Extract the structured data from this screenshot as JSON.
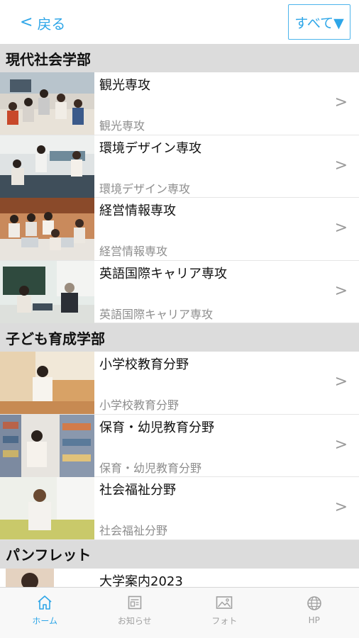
{
  "topbar": {
    "back_label": "戻る",
    "filter_label": "すべて▼"
  },
  "sections": [
    {
      "title": "現代社会学部",
      "rows": [
        {
          "title": "観光専攻",
          "subtitle": "観光専攻",
          "photo": "classroom-group"
        },
        {
          "title": "環境デザイン専攻",
          "subtitle": "環境デザイン専攻",
          "photo": "laboratory"
        },
        {
          "title": "経営情報専攻",
          "subtitle": "経営情報専攻",
          "photo": "computer-room"
        },
        {
          "title": "英語国際キャリア専攻",
          "subtitle": "英語国際キャリア専攻",
          "photo": "tutor-session"
        }
      ]
    },
    {
      "title": "子ども育成学部",
      "rows": [
        {
          "title": "小学校教育分野",
          "subtitle": "小学校教育分野",
          "photo": "student-desk"
        },
        {
          "title": "保育・幼児教育分野",
          "subtitle": "保育・幼児教育分野",
          "photo": "library-student"
        },
        {
          "title": "社会福祉分野",
          "subtitle": "社会福祉分野",
          "photo": "student-portrait"
        }
      ]
    },
    {
      "title": "パンフレット",
      "rows": [
        {
          "title": "大学案内2023",
          "subtitle": "",
          "photo": "brochure-cover"
        }
      ]
    }
  ],
  "tabbar": {
    "tabs": [
      {
        "label": "ホーム",
        "icon": "home-icon",
        "active": true
      },
      {
        "label": "お知らせ",
        "icon": "news-icon",
        "active": false
      },
      {
        "label": "フォト",
        "icon": "photo-icon",
        "active": false
      },
      {
        "label": "HP",
        "icon": "globe-icon",
        "active": false
      }
    ]
  },
  "colors": {
    "accent": "#2ea6e8",
    "section_bg": "#dcdcdc",
    "subtitle": "#8e8e8e",
    "tab_inactive": "#a0a0a0"
  },
  "chevron_glyph": ">"
}
